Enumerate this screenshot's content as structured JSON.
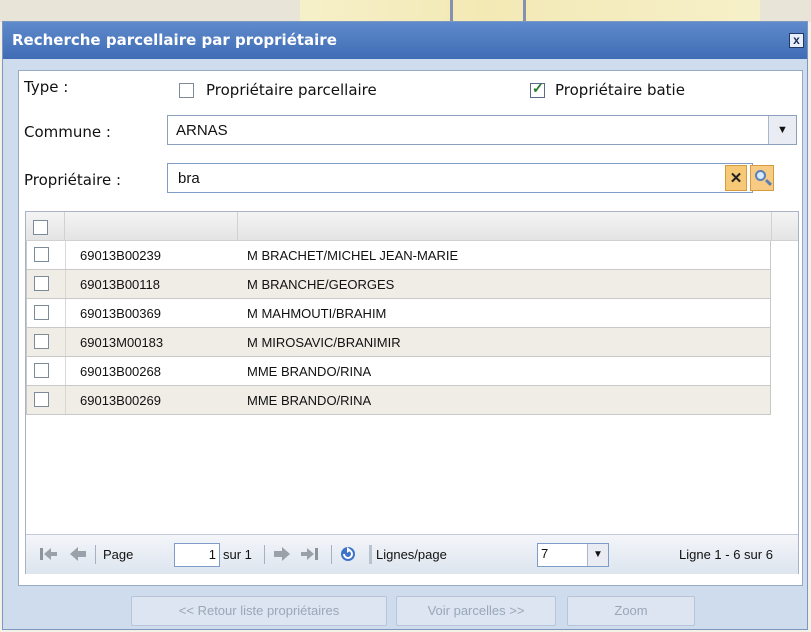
{
  "window": {
    "title": "Recherche parcellaire par propriétaire",
    "close_label": "x"
  },
  "form": {
    "type_label": "Type :",
    "type_options": [
      {
        "label": "Propriétaire parcellaire",
        "checked": false
      },
      {
        "label": "Propriétaire batie",
        "checked": true
      }
    ],
    "commune_label": "Commune :",
    "commune_value": "ARNAS",
    "owner_label": "Propriétaire :",
    "owner_value": "bra"
  },
  "grid": {
    "rows": [
      {
        "id": "69013B00239",
        "name": "M BRACHET/MICHEL JEAN-MARIE"
      },
      {
        "id": "69013B00118",
        "name": "M BRANCHE/GEORGES"
      },
      {
        "id": "69013B00369",
        "name": "M MAHMOUTI/BRAHIM"
      },
      {
        "id": "69013M00183",
        "name": "M MIROSAVIC/BRANIMIR"
      },
      {
        "id": "69013B00268",
        "name": "MME BRANDO/RINA"
      },
      {
        "id": "69013B00269",
        "name": "MME BRANDO/RINA"
      }
    ]
  },
  "pager": {
    "page_label": "Page",
    "page_value": "1",
    "of_label": "sur 1",
    "lines_label": "Lignes/page",
    "lines_value": "7",
    "summary": "Ligne 1 - 6 sur 6"
  },
  "buttons": {
    "back": "<< Retour liste propriétaires",
    "parcels": "Voir parcelles >>",
    "zoom": "Zoom"
  }
}
